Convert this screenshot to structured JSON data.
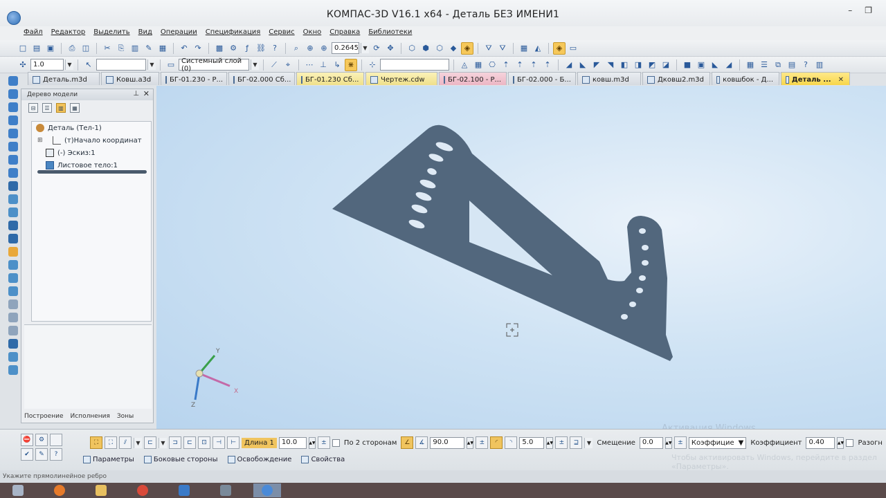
{
  "window": {
    "title": "КОМПАС-3D V16.1 x64 - Деталь БЕЗ ИМЕНИ1",
    "min": "–",
    "max": "❐",
    "close": "✕"
  },
  "menu": [
    "Файл",
    "Редактор",
    "Выделить",
    "Вид",
    "Операции",
    "Спецификация",
    "Сервис",
    "Окно",
    "Справка",
    "Библиотеки"
  ],
  "toolbar1": {
    "zoom_value": "0.2645"
  },
  "toolbar2": {
    "step_value": "1.0",
    "layer_value": "Системный слой (0)"
  },
  "tabs": [
    {
      "label": "Деталь.m3d",
      "style": "normal"
    },
    {
      "label": "Ковш.a3d",
      "style": "normal"
    },
    {
      "label": "БГ-01.230 - Р...",
      "style": "normal"
    },
    {
      "label": "БГ-02.000 Сб...",
      "style": "normal"
    },
    {
      "label": "БГ-01.230 Сб...",
      "style": "yellow"
    },
    {
      "label": "Чертеж.cdw",
      "style": "yellow"
    },
    {
      "label": "БГ-02.100 - Р...",
      "style": "pink"
    },
    {
      "label": "БГ-02.000 - Б...",
      "style": "normal"
    },
    {
      "label": "ковш.m3d",
      "style": "normal"
    },
    {
      "label": "Дковш2.m3d",
      "style": "normal"
    },
    {
      "label": "ковшбок - Д...",
      "style": "normal"
    },
    {
      "label": "Деталь ...",
      "style": "active"
    }
  ],
  "tree_panel": {
    "title": "Дерево модели",
    "pin": "⊥",
    "close": "✕",
    "items": [
      {
        "label": "Деталь (Тел-1)",
        "indent": 0,
        "prefix": ""
      },
      {
        "label": "(т)Начало координат",
        "indent": 1,
        "prefix": "⊞"
      },
      {
        "label": "(-) Эскиз:1",
        "indent": 1,
        "prefix": ""
      },
      {
        "label": "Листовое тело:1",
        "indent": 1,
        "prefix": ""
      }
    ],
    "footer_tabs": [
      "Построение",
      "Исполнения",
      "Зоны"
    ]
  },
  "properties": {
    "length_label": "Длина 1",
    "length_value": "10.0",
    "both_sides_label": "По 2 сторонам",
    "angle_value": "90.0",
    "radius_value": "5.0",
    "offset_label": "Смещение",
    "offset_value": "0.0",
    "coef_dropdown": "Коэффицие",
    "coef_label": "Коэффициент",
    "coef_value": "0.40",
    "unfold_label": "Разогн",
    "tabs": [
      "Параметры",
      "Боковые стороны",
      "Освобождение",
      "Свойства"
    ]
  },
  "viewport": {
    "axis_x": "X",
    "axis_y": "Y",
    "axis_z": "Z"
  },
  "status": {
    "hint": "Укажите прямолинейное ребро"
  },
  "watermark": {
    "line1": "Активация Windows",
    "line2": "Чтобы активировать Windows, перейдите в раздел «Параметры»."
  },
  "colors": {
    "part": "#52677d",
    "accent": "#f2c85a",
    "viewport": "#cfe3f4"
  }
}
